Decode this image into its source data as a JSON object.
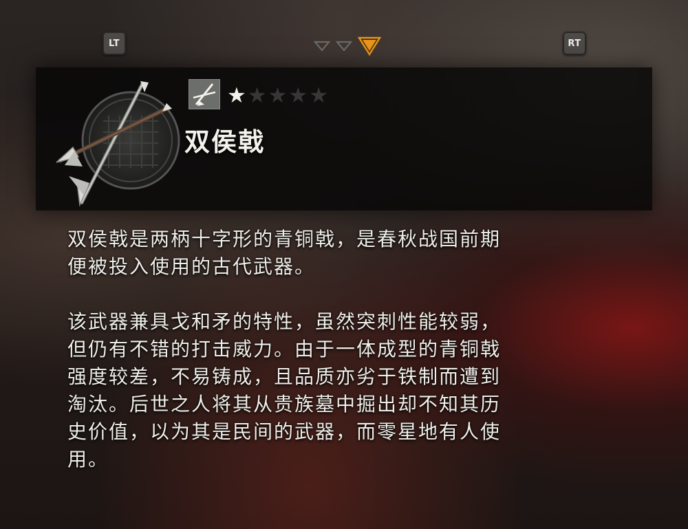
{
  "top_bar": {
    "left_button": "LT",
    "right_button": "RT",
    "page_indicators": [
      {
        "state": "inactive",
        "color": "#6a6a6a"
      },
      {
        "state": "inactive",
        "color": "#6a6a6a"
      },
      {
        "state": "active",
        "color": "#e8961c"
      }
    ]
  },
  "item": {
    "name": "双侯戟",
    "weapon_icon": "crossed-halberds-icon",
    "type_icon": "halberd-type-icon",
    "rating": 1,
    "rating_max": 5,
    "stars": [
      {
        "glyph": "★",
        "filled": true
      },
      {
        "glyph": "★",
        "filled": false
      },
      {
        "glyph": "★",
        "filled": false
      },
      {
        "glyph": "★",
        "filled": false
      },
      {
        "glyph": "★",
        "filled": false
      }
    ]
  },
  "description": {
    "lines_p1": [
      "双侯戟是两柄十字形的青铜戟，是春秋战国前期",
      "便被投入使用的古代武器。"
    ],
    "lines_p2": [
      "该武器兼具戈和矛的特性，虽然突刺性能较弱，",
      "但仍有不错的打击威力。由于一体成型的青铜戟",
      "强度较差，不易铸成，且品质亦劣于铁制而遭到",
      "淘汰。后世之人将其从贵族墓中掘出却不知其历",
      "史价值，以为其是民间的武器，而零星地有人使",
      "用。"
    ]
  },
  "colors": {
    "accent": "#e8961c",
    "text": "#f1efe9",
    "panel": "#060606"
  }
}
